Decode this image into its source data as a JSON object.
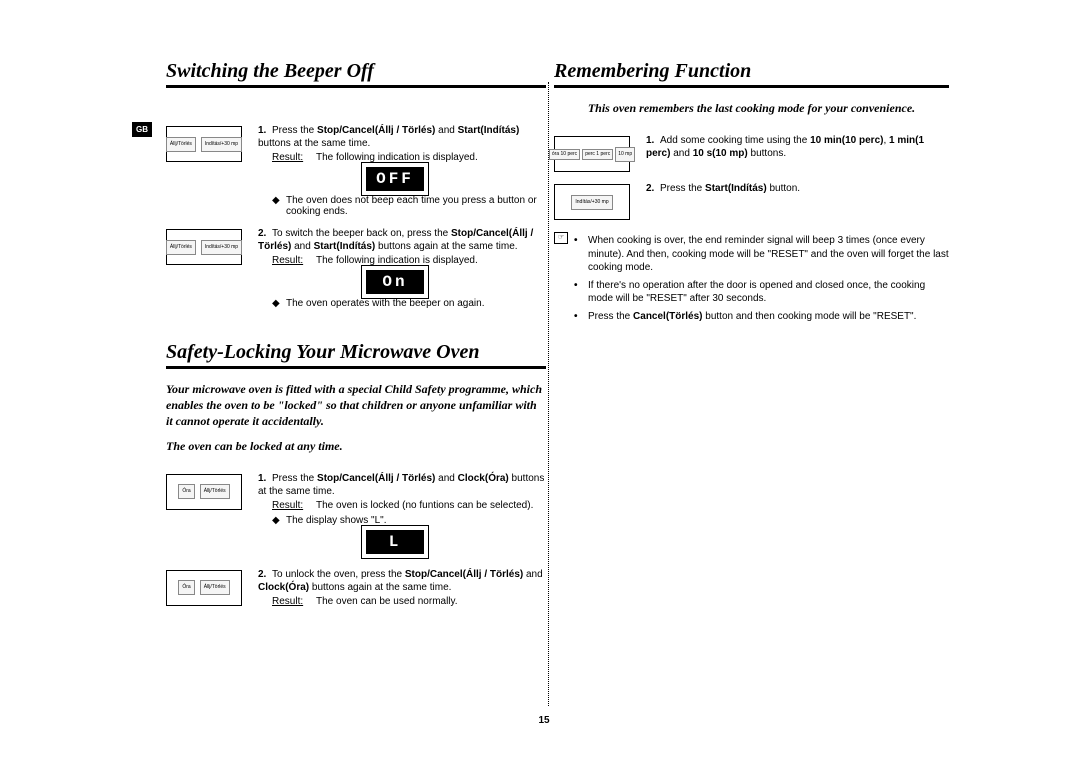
{
  "badge": "GB",
  "page_number": "15",
  "left": {
    "beeper": {
      "title": "Switching the Beeper Off",
      "steps": [
        {
          "num": "1.",
          "illus_btns": [
            "Állj/Törlés",
            "Indítás/+30 mp"
          ],
          "text_pre": "Press the ",
          "bold1": "Stop/Cancel(Állj / Törlés)",
          "mid": " and ",
          "bold2": "Start(Indítás)",
          "text_post": " buttons at the same time.",
          "result_label": "Result:",
          "result_text": "The following indication is displayed.",
          "lcd": "OFF",
          "diamond": "◆",
          "diamond_text": "The oven does not beep each time you press a button or cooking ends."
        },
        {
          "num": "2.",
          "illus_btns": [
            "Állj/Törlés",
            "Indítás/+30 mp"
          ],
          "text_pre": "To switch the beeper back on, press the ",
          "bold1": "Stop/Cancel(Állj / Törlés)",
          "mid": " and ",
          "bold2": "Start(Indítás)",
          "text_post": " buttons again at the same time.",
          "result_label": "Result:",
          "result_text": "The following indication is displayed.",
          "lcd": "On",
          "diamond": "◆",
          "diamond_text": "The oven operates with the beeper on again."
        }
      ]
    },
    "safety": {
      "title": "Safety-Locking Your Microwave Oven",
      "intro1": "Your microwave oven is fitted with a special Child Safety programme, which enables the oven to be \"locked\" so that children or anyone unfamiliar with it cannot operate it accidentally.",
      "intro2": "The oven can be locked at any time.",
      "steps": [
        {
          "num": "1.",
          "illus_btns": [
            "Óra",
            "Állj/Törlés"
          ],
          "text_pre": "Press the ",
          "bold1": "Stop/Cancel(Állj / Törlés)",
          "mid": " and ",
          "bold2": "Clock(Óra)",
          "text_post": " buttons at the same time.",
          "result_label": "Result:",
          "result_text": "The oven is locked (no funtions can be selected).",
          "diamond": "◆",
          "diamond_text": "The display shows \"L\".",
          "lcd": "L"
        },
        {
          "num": "2.",
          "illus_btns": [
            "Óra",
            "Állj/Törlés"
          ],
          "text_pre": "To unlock the oven, press the  ",
          "bold1": "Stop/Cancel(Állj / Törlés)",
          "mid": " and ",
          "bold2": "Clock(Óra)",
          "text_post": " buttons again at the same time.",
          "result_label": "Result:",
          "result_text": "The oven can be used normally."
        }
      ]
    }
  },
  "right": {
    "remember": {
      "title": "Remembering Function",
      "intro": "This oven remembers the last cooking mode for your convenience.",
      "steps": [
        {
          "num": "1.",
          "illus_btns": [
            "óra\n10 perc",
            "perc\n1 perc",
            "10 mp"
          ],
          "text_pre": "Add some cooking time using the ",
          "bold1": "10 min(10 perc)",
          "mid1": ", ",
          "bold2": "1 min(1 perc)",
          "mid2": " and ",
          "bold3": "10 s(10 mp)",
          "text_post": " buttons."
        },
        {
          "num": "2.",
          "illus_btns": [
            "Indítás/+30 mp"
          ],
          "text_pre": "Press the ",
          "bold1": "Start(Indítás)",
          "text_post": " button."
        }
      ],
      "note_icon": "☞",
      "bullets": [
        "When cooking is over, the end reminder signal will beep 3 times (once every minute). And then, cooking mode will be \"RESET\" and the oven will forget the last cooking mode.",
        "If there's no operation after the door is opened and closed once, the cooking mode will be \"RESET\" after 30 seconds.",
        "Press the Cancel(Törlés) button and then cooking mode will be \"RESET\"."
      ],
      "bullet3_pre": "Press the ",
      "bullet3_bold": "Cancel(Törlés)",
      "bullet3_post": " button and then cooking mode will be \"RESET\"."
    }
  }
}
